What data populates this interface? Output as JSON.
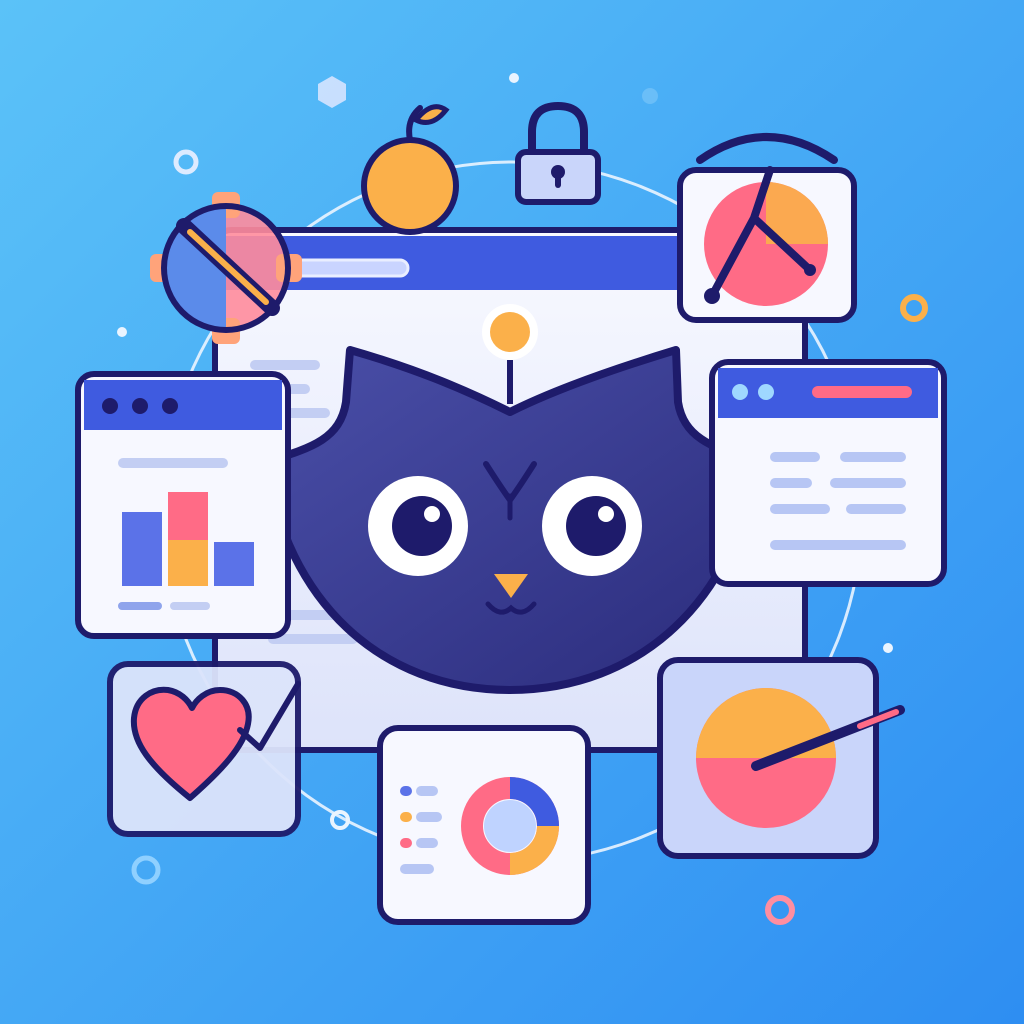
{
  "meta": {
    "visible_text": []
  },
  "palette": {
    "background_light": "#5BC2F8",
    "background_dark": "#2E8EF2",
    "navy": "#1E1B6B",
    "mascot": "#3A3B8F",
    "window_white": "#F7F8FF",
    "window_tint": "#E4E8FB",
    "title_bar": "#3F5BE0",
    "accent_orange": "#FBB04A",
    "accent_pink": "#FF6B86",
    "accent_blue": "#5B72E8",
    "line_blue": "#B7C6F4",
    "ring": "#EAF4FF"
  },
  "icons": {
    "mascot": "owl-cat-mascot-icon",
    "browser": "browser-window-icon",
    "bar_chart": "bar-chart-icon",
    "text_list": "text-list-icon",
    "favorites": "heart-icon",
    "donut": "donut-chart-icon",
    "pie_pen": "pie-chart-pen-icon",
    "settings_edit": "gear-pencil-icon",
    "fruit": "orange-fruit-icon",
    "lock": "padlock-icon",
    "clock": "clock-chart-icon"
  },
  "cards": [
    {
      "name": "bar-chart-card",
      "icon": "bar-chart-icon"
    },
    {
      "name": "text-list-card",
      "icon": "text-list-icon"
    },
    {
      "name": "favorites-card",
      "icon": "heart-icon"
    },
    {
      "name": "donut-chart-card",
      "icon": "donut-chart-icon"
    },
    {
      "name": "pie-chart-pen-card",
      "icon": "pie-chart-pen-icon"
    },
    {
      "name": "clock-chart-card",
      "icon": "clock-chart-icon"
    }
  ]
}
